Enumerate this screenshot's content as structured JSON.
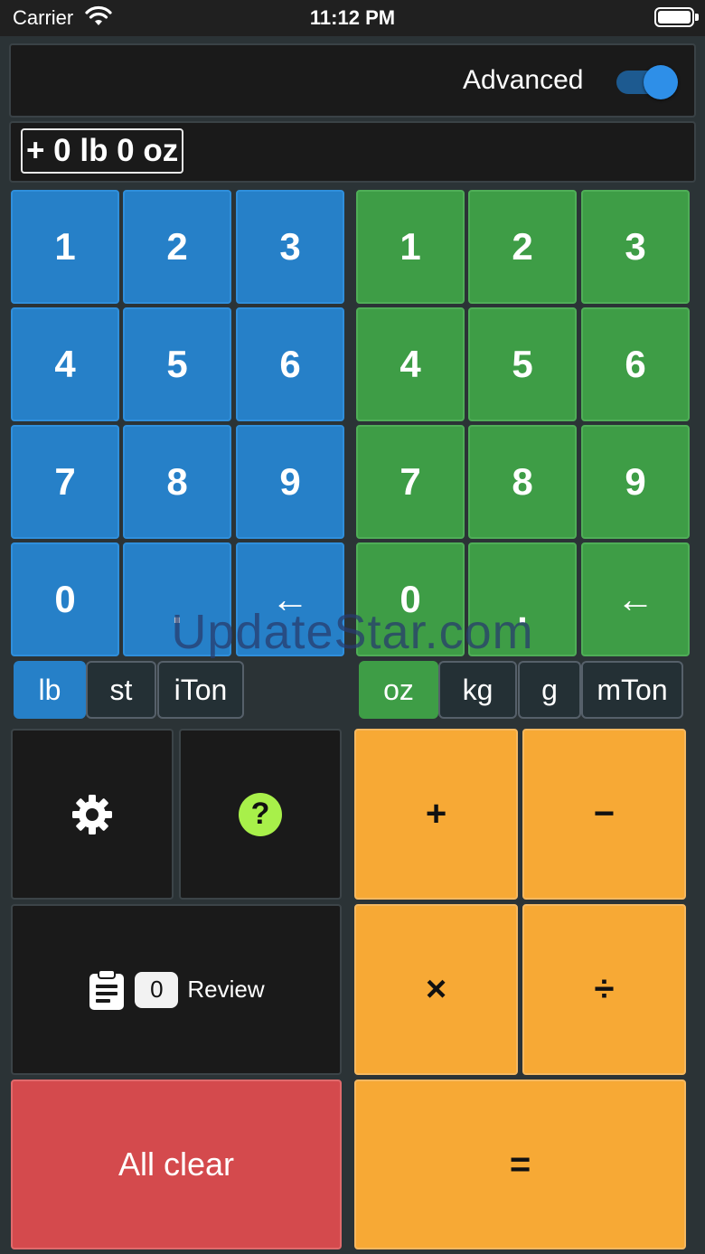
{
  "status_bar": {
    "carrier": "Carrier",
    "time": "11:12 PM"
  },
  "header": {
    "advanced_label": "Advanced",
    "advanced_on": true
  },
  "expression": "+ 0 lb 0 oz",
  "left_keypad": {
    "color": "#2680c8",
    "keys": [
      "1",
      "2",
      "3",
      "4",
      "5",
      "6",
      "7",
      "8",
      "9",
      "0",
      ".",
      "←"
    ]
  },
  "right_keypad": {
    "color": "#3e9d46",
    "keys": [
      "1",
      "2",
      "3",
      "4",
      "5",
      "6",
      "7",
      "8",
      "9",
      "0",
      ".",
      "←"
    ]
  },
  "left_units": {
    "items": [
      "lb",
      "st",
      "iTon"
    ],
    "selected": "lb"
  },
  "right_units": {
    "items": [
      "oz",
      "kg",
      "g",
      "mTon"
    ],
    "selected": "oz"
  },
  "controls": {
    "settings_icon": "gear-icon",
    "help_icon": "question-icon",
    "help_glyph": "?",
    "review_icon": "clipboard-icon",
    "review_count": "0",
    "review_label": "Review",
    "clear_label": "All clear"
  },
  "operators": {
    "plus": "+",
    "minus": "−",
    "multiply": "×",
    "divide": "÷",
    "equals": "="
  },
  "watermark": "UpdateStar.com",
  "colors": {
    "operator": "#f7a935",
    "clear": "#d44a4d",
    "help": "#a8f04a"
  }
}
